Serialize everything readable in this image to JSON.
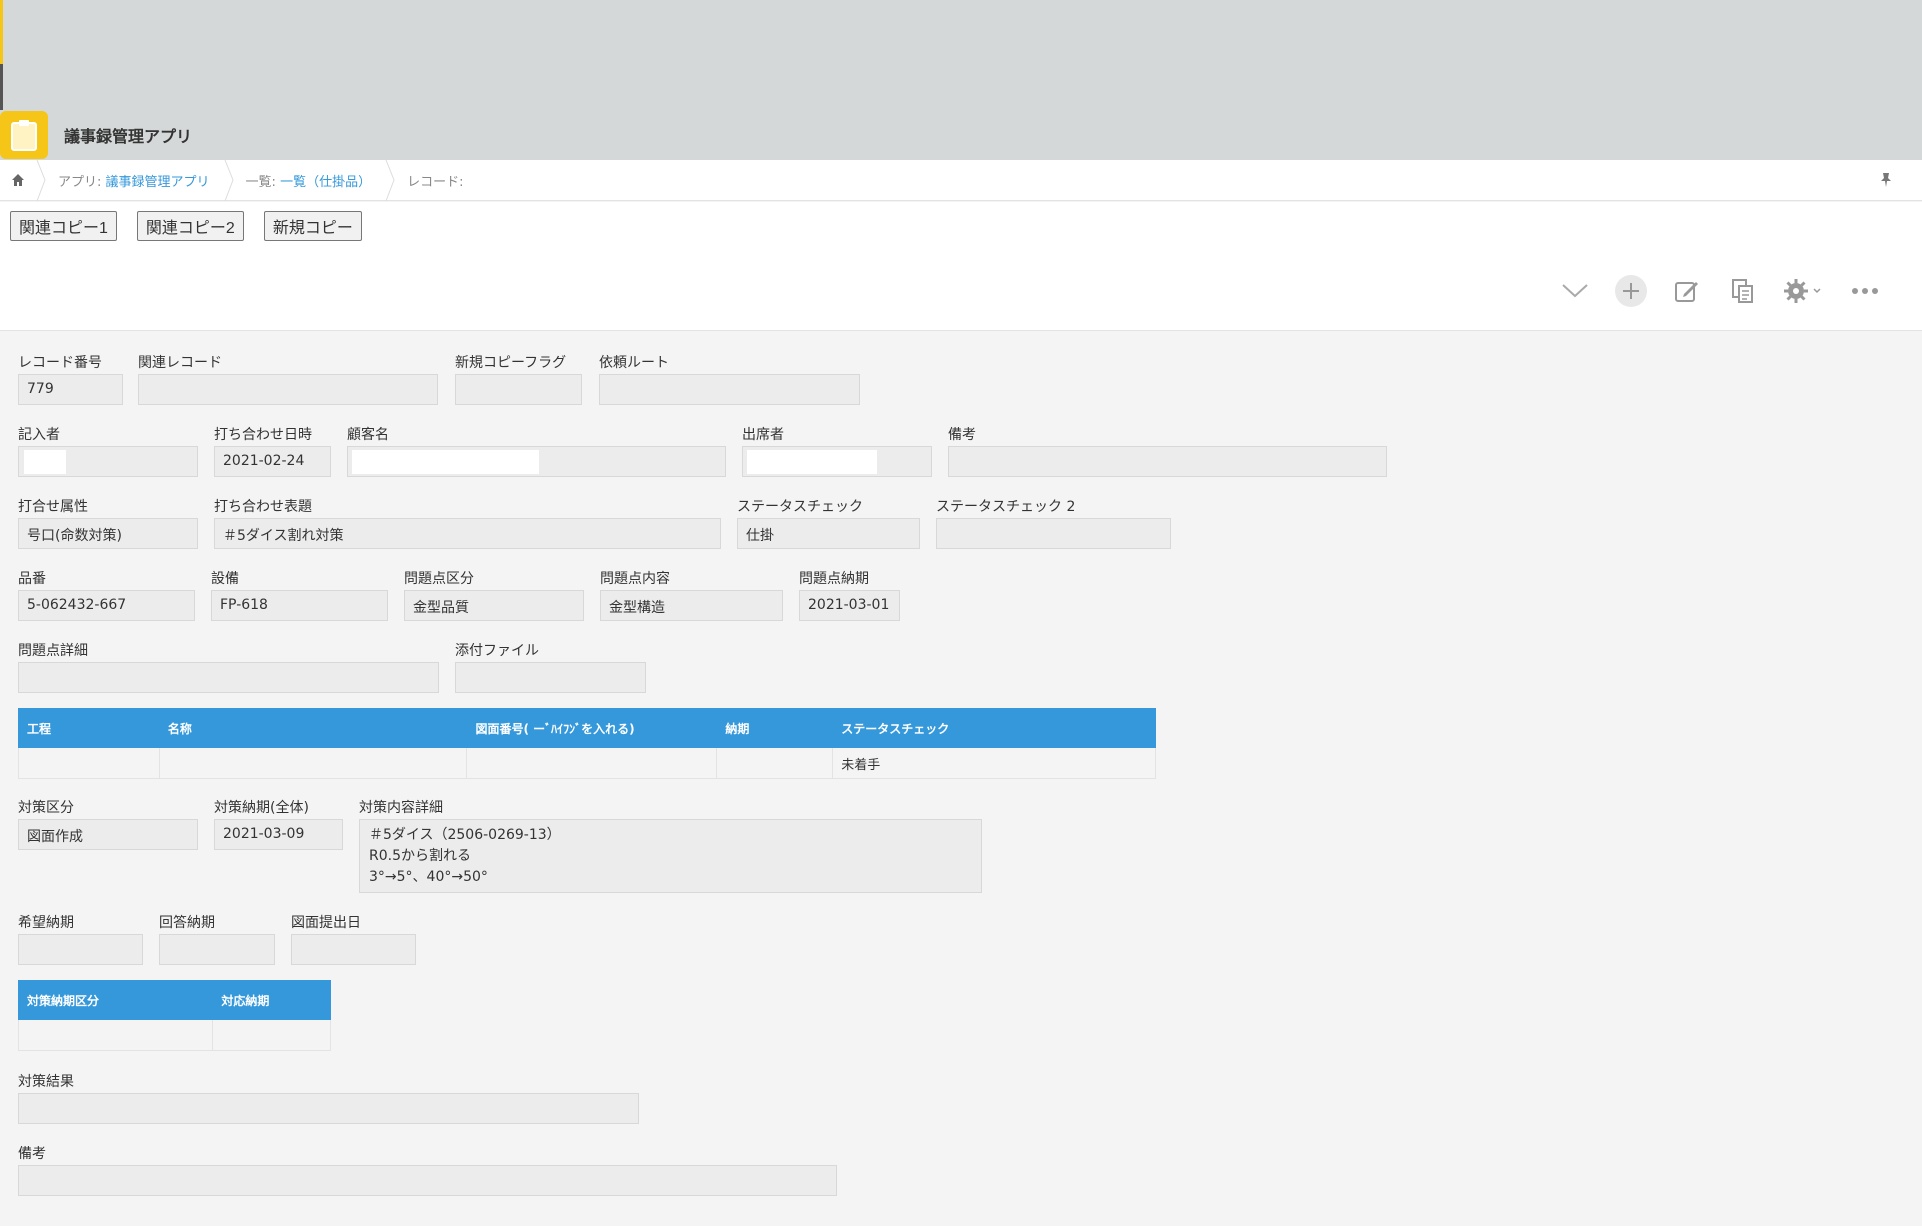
{
  "app": {
    "title": "議事録管理アプリ"
  },
  "breadcrumb": {
    "app_prefix": "アプリ:",
    "app_name": "議事録管理アプリ",
    "list_prefix": "一覧:",
    "list_name": "一覧（仕掛品）",
    "record_prefix": "レコード:"
  },
  "copy_buttons": {
    "related1": "関連コピー1",
    "related2": "関連コピー2",
    "new_copy": "新規コピー"
  },
  "fields": {
    "record_no": {
      "label": "レコード番号",
      "value": "779"
    },
    "related_record": {
      "label": "関連レコード",
      "value": ""
    },
    "new_copy_flag": {
      "label": "新規コピーフラグ",
      "value": ""
    },
    "request_route": {
      "label": "依頼ルート",
      "value": ""
    },
    "writer": {
      "label": "記入者",
      "value": ""
    },
    "meeting_date": {
      "label": "打ち合わせ日時",
      "value": "2021-02-24"
    },
    "customer": {
      "label": "顧客名",
      "value": ""
    },
    "attendee": {
      "label": "出席者",
      "value": ""
    },
    "remarks1": {
      "label": "備考",
      "value": ""
    },
    "meeting_attr": {
      "label": "打合せ属性",
      "value": "号口(命数対策)"
    },
    "meeting_title": {
      "label": "打ち合わせ表題",
      "value": "＃5ダイス割れ対策"
    },
    "status_check": {
      "label": "ステータスチェック",
      "value": "仕掛"
    },
    "status_check2": {
      "label": "ステータスチェック 2",
      "value": ""
    },
    "part_no": {
      "label": "品番",
      "value": "5-062432-667"
    },
    "equipment": {
      "label": "設備",
      "value": "FP-618"
    },
    "issue_category": {
      "label": "問題点区分",
      "value": "金型品質"
    },
    "issue_content": {
      "label": "問題点内容",
      "value": "金型構造"
    },
    "issue_due": {
      "label": "問題点納期",
      "value": "2021-03-01"
    },
    "issue_detail": {
      "label": "問題点詳細",
      "value": ""
    },
    "attachment": {
      "label": "添付ファイル",
      "value": ""
    },
    "measure_category": {
      "label": "対策区分",
      "value": "図面作成"
    },
    "measure_due_total": {
      "label": "対策納期(全体)",
      "value": "2021-03-09"
    },
    "measure_detail": {
      "label": "対策内容詳細",
      "line1": "＃5ダイス（2506-0269-13）",
      "line2": "R0.5から割れる",
      "line3": "3°→5°、40°→50°"
    },
    "desired_due": {
      "label": "希望納期",
      "value": ""
    },
    "answer_due": {
      "label": "回答納期",
      "value": ""
    },
    "drawing_submit": {
      "label": "図面提出日",
      "value": ""
    },
    "measure_result": {
      "label": "対策結果",
      "value": ""
    },
    "remarks2": {
      "label": "備考",
      "value": ""
    }
  },
  "process_table": {
    "headers": [
      "工程",
      "名称",
      "図面番号( ーﾞﾊｲﾌﾝﾞを入れる)",
      "納期",
      "ステータスチェック"
    ],
    "rows": [
      [
        "",
        "",
        "",
        "",
        "未着手"
      ]
    ]
  },
  "due_table": {
    "headers": [
      "対策納期区分",
      "対応納期"
    ],
    "rows": [
      [
        "",
        ""
      ]
    ]
  },
  "icons": [
    "home-icon",
    "pin-icon",
    "chevron-down-icon",
    "plus-icon",
    "edit-icon",
    "duplicate-icon",
    "gear-icon",
    "more-icon"
  ],
  "colors": {
    "accent": "#3498db",
    "app_icon": "#f5c518",
    "header_bg": "#d5d8d9"
  }
}
